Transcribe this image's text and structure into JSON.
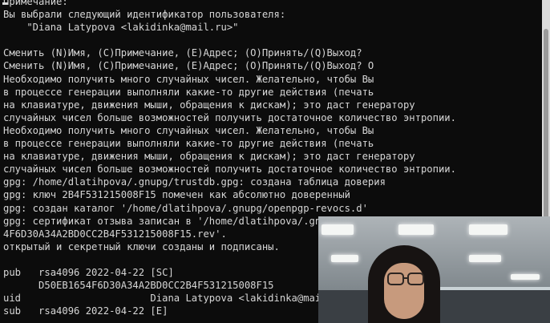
{
  "terminal": {
    "lines": [
      "Примечание:",
      "Вы выбрали следующий идентификатор пользователя:",
      "    \"Diana Latypova <lakidinka@mail.ru>\"",
      "",
      "Сменить (N)Имя, (C)Примечание, (E)Адрес; (O)Принять/(Q)Выход?",
      "Сменить (N)Имя, (C)Примечание, (E)Адрес; (O)Принять/(Q)Выход? O",
      "Необходимо получить много случайных чисел. Желательно, чтобы Вы",
      "в процессе генерации выполняли какие-то другие действия (печать",
      "на клавиатуре, движения мыши, обращения к дискам); это даст генератору",
      "случайных чисел больше возможностей получить достаточное количество энтропии.",
      "Необходимо получить много случайных чисел. Желательно, чтобы Вы",
      "в процессе генерации выполняли какие-то другие действия (печать",
      "на клавиатуре, движения мыши, обращения к дискам); это даст генератору",
      "случайных чисел больше возможностей получить достаточное количество энтропии.",
      "gpg: /home/dlatihpova/.gnupg/trustdb.gpg: создана таблица доверия",
      "gpg: ключ 2B4F531215008F15 помечен как абсолютно доверенный",
      "gpg: создан каталог '/home/dlatihpova/.gnupg/openpgp-revocs.d'",
      "gpg: сертификат отзыва записан в '/home/dlatihpova/.gnupg/openpgp-revocs.d/D50EB1654",
      "4F6D30A34A2BD0CC2B4F531215008F15.rev'.",
      "открытый и секретный ключи созданы и подписаны.",
      "",
      "pub   rsa4096 2022-04-22 [SC]",
      "      D50EB1654F6D30A34A2BD0CC2B4F531215008F15",
      "uid                      Diana Latypova <lakidinka@mail.ru>",
      "sub   rsa4096 2022-04-22 [E]"
    ]
  },
  "colors": {
    "background": "#0c0c0c",
    "text": "#d6d6d6"
  }
}
